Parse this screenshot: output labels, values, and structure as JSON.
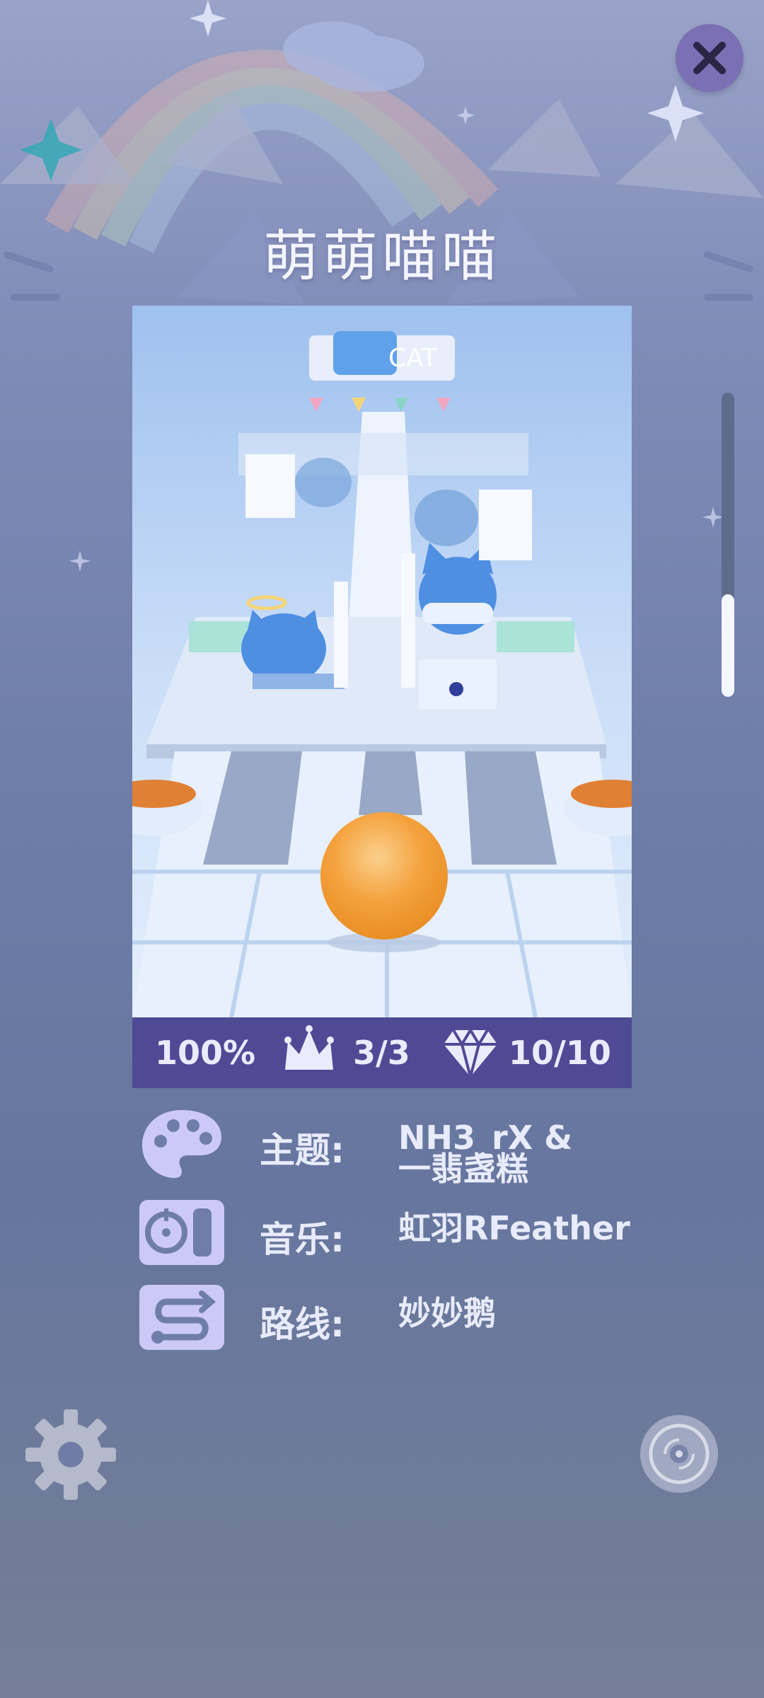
{
  "level": {
    "title": "萌萌喵喵"
  },
  "preview": {
    "sign_text": "CAT"
  },
  "stats": {
    "progress": "100%",
    "crowns": "3/3",
    "gems": "10/10"
  },
  "scroll": {
    "position_fraction": 0.66
  },
  "info": [
    {
      "icon": "palette-icon",
      "label": "主题:",
      "value_line1": "NH3_rX &",
      "value_line2": "一翡盏糕"
    },
    {
      "icon": "music-player-icon",
      "label": "音乐:",
      "value_line1": "虹羽RFeather",
      "value_line2": ""
    },
    {
      "icon": "route-icon",
      "label": "路线:",
      "value_line1": "妙妙鹅",
      "value_line2": ""
    }
  ],
  "icons": {
    "close": "close-icon",
    "settings": "gear-icon",
    "music": "music-disc-icon"
  },
  "colors": {
    "stats_bar": "#4e4a94",
    "icon_tint": "#cdc9f6",
    "ball": "#f4a23e"
  }
}
